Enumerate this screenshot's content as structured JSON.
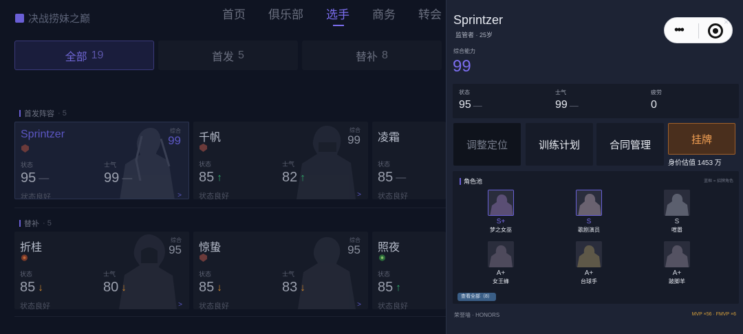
{
  "header": {
    "logo_text": "决战捞妹之巅",
    "nav": [
      "首页",
      "俱乐部",
      "选手",
      "商务",
      "转会"
    ],
    "active_nav": "选手"
  },
  "filters": [
    {
      "label": "全部",
      "count": "19",
      "active": true
    },
    {
      "label": "首发",
      "count": "5",
      "active": false
    },
    {
      "label": "替补",
      "count": "8",
      "active": false
    }
  ],
  "sections": {
    "starters": {
      "label": "首发阵容",
      "count": "· 5"
    },
    "subs": {
      "label": "替补",
      "count": "· 5"
    }
  },
  "card_labels": {
    "overall": "综合",
    "status": "状态",
    "morale": "士气",
    "condition": "状态良好",
    "more": ">"
  },
  "starters": [
    {
      "name": "Sprintzer",
      "overall": "99",
      "status": "95",
      "status_trend": "—",
      "morale": "99",
      "morale_trend": "—",
      "selected": true
    },
    {
      "name": "千帆",
      "overall": "99",
      "status": "85",
      "status_trend": "↑",
      "morale": "82",
      "morale_trend": "↑"
    },
    {
      "name": "凌霜",
      "overall": "",
      "status": "85",
      "status_trend": "—",
      "morale": "",
      "morale_trend": ""
    }
  ],
  "subs": [
    {
      "name": "折桂",
      "overall": "95",
      "status": "85",
      "status_trend": "↓",
      "morale": "80",
      "morale_trend": "↓"
    },
    {
      "name": "惊蛰",
      "overall": "95",
      "status": "85",
      "status_trend": "↓",
      "morale": "83",
      "morale_trend": "↓"
    },
    {
      "name": "照夜",
      "overall": "",
      "status": "85",
      "status_trend": "↑",
      "morale": "",
      "morale_trend": ""
    }
  ],
  "panel": {
    "name": "Sprintzer",
    "sub": "监管者 · 25岁",
    "overall_label": "综合能力",
    "overall": "99",
    "stats": [
      {
        "label": "状态",
        "value": "95",
        "trend": "—"
      },
      {
        "label": "士气",
        "value": "99",
        "trend": "—"
      },
      {
        "label": "疲劳",
        "value": "0",
        "trend": ""
      }
    ],
    "buttons": [
      "调整定位",
      "训练计划",
      "合同管理",
      "挂牌"
    ],
    "value_text": "身价估值 1453 万",
    "pool_title": "角色池",
    "pool_hint": "蓝框 = 招牌角色",
    "characters": [
      {
        "grade": "S+",
        "name": "梦之女巫",
        "signature": true
      },
      {
        "grade": "S",
        "name": "歌剧演员",
        "signature": true
      },
      {
        "grade": "S",
        "name": "喧嚣",
        "signature": false
      },
      {
        "grade": "A+",
        "name": "女王蜂",
        "signature": false
      },
      {
        "grade": "A+",
        "name": "台球手",
        "signature": false
      },
      {
        "grade": "A+",
        "name": "跛脚羊",
        "signature": false
      }
    ],
    "view_all": "查看全部（8）",
    "honors": "荣誉墙 · HONORS",
    "mvp": "MVP ×56 · FMVP ×6"
  },
  "colors": {
    "accent": "#7c6ef0",
    "up": "#2fae6c",
    "down": "#d3892c",
    "hang": "#f4a154"
  }
}
